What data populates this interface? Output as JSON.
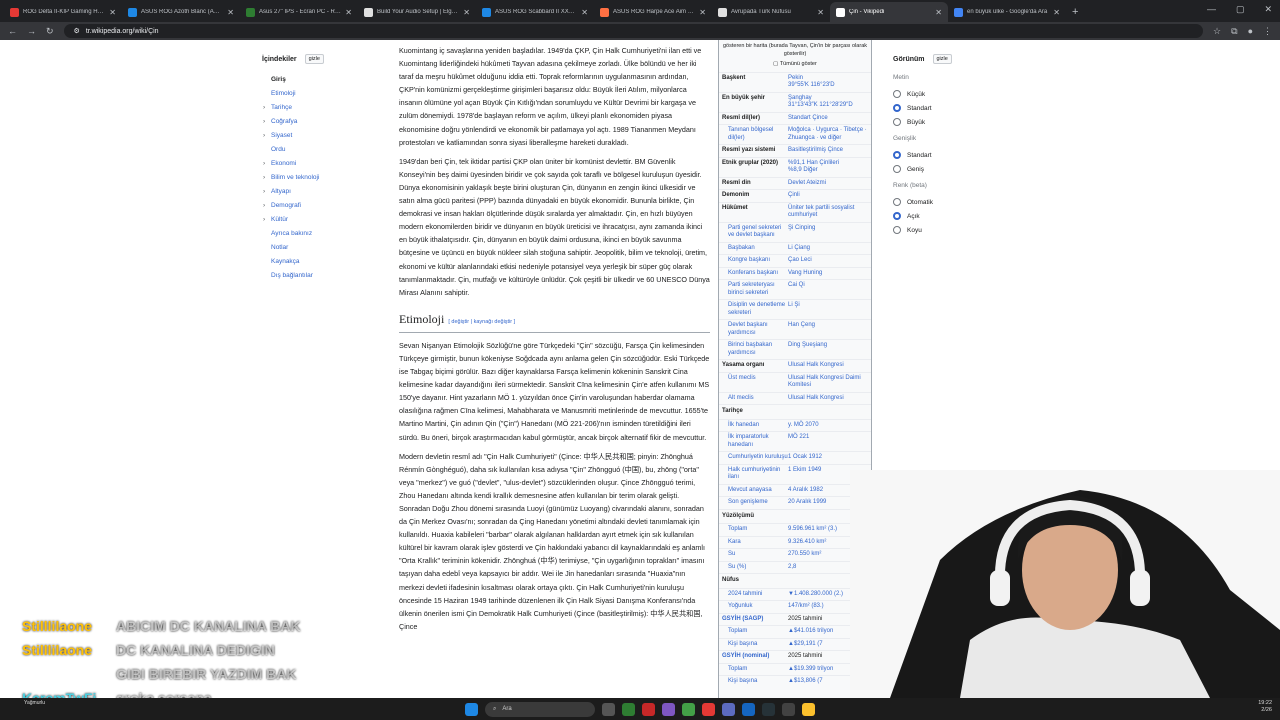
{
  "tabs": [
    {
      "label": "ROG Delta II-KIP Gaming Head",
      "color": "#e53935"
    },
    {
      "label": "ASUS ROG Azoth Blanc (AZERTY)",
      "color": "#1e88e5"
    },
    {
      "label": "Asus 27\" IPS - Ecran PC - Rue du",
      "color": "#2e7d32"
    },
    {
      "label": "Build Your Audio Setup | Elgato",
      "color": "#e0e0e0"
    },
    {
      "label": "ASUS ROG Scabbard II XXL (Ani",
      "color": "#1e88e5"
    },
    {
      "label": "ASUS ROG Harpe Ace Aim Lab",
      "color": "#ff7043"
    },
    {
      "label": "Avrupada Türk Nüfusu",
      "color": "#e0e0e0"
    },
    {
      "label": "Çin - Vikipedi",
      "color": "#ffffff",
      "active": true
    },
    {
      "label": "en büyük ülke - Google'da Ara",
      "color": "#4285f4"
    }
  ],
  "newtab": "+",
  "url": "tr.wikipedia.org/wiki/Çin",
  "toc": {
    "title": "İçindekiler",
    "hide": "gizle",
    "items": [
      {
        "label": "Giriş",
        "current": true,
        "chevron": false
      },
      {
        "label": "Etimoloji",
        "chevron": false
      },
      {
        "label": "Tarihçe",
        "chevron": true
      },
      {
        "label": "Coğrafya",
        "chevron": true
      },
      {
        "label": "Siyaset",
        "chevron": true
      },
      {
        "label": "Ordu",
        "chevron": false
      },
      {
        "label": "Ekonomi",
        "chevron": true
      },
      {
        "label": "Bilim ve teknoloji",
        "chevron": true
      },
      {
        "label": "Altyapı",
        "chevron": true
      },
      {
        "label": "Demografi",
        "chevron": true
      },
      {
        "label": "Kültür",
        "chevron": true
      },
      {
        "label": "Ayrıca bakınız",
        "chevron": false
      },
      {
        "label": "Notlar",
        "chevron": false
      },
      {
        "label": "Kaynakça",
        "chevron": false
      },
      {
        "label": "Dış bağlantılar",
        "chevron": false
      }
    ]
  },
  "article": {
    "p1": "Kuomintang iç savaşlarına yeniden başladılar. 1949'da ÇKP, Çin Halk Cumhuriyeti'ni ilan etti ve Kuomintang liderliğindeki hükûmeti Tayvan adasına çekilmeye zorladı. Ülke bölündü ve her iki taraf da meşru hükûmet olduğunu iddia etti. Toprak reformlarının uygulanmasının ardından, ÇKP'nin komünizmi gerçekleştirme girişimleri başarısız oldu: Büyük İleri Atılım, milyonlarca insanın ölümüne yol açan Büyük Çin Kıtlığı'ndan sorumluydu ve Kültür Devrimi bir kargaşa ve zulüm dönemiydi. 1978'de başlayan reform ve açılım, ülkeyi planlı ekonomiden piyasa ekonomisine doğru yönlendirdi ve ekonomik bir patlamaya yol açtı. 1989 Tiananmen Meydanı protestoları ve katliamından sonra siyasi liberalleşme hareketi durakladı.",
    "p2": "1949'dan beri Çin, tek iktidar partisi ÇKP olan üniter bir komünist devlettir. BM Güvenlik Konseyi'nin beş daimi üyesinden biridir ve çok sayıda çok taraflı ve bölgesel kuruluşun üyesidir. Dünya ekonomisinin yaklaşık beşte birini oluşturan Çin, dünyanın en zengin ikinci ülkesidir ve satın alma gücü paritesi (PPP) bazında dünyadaki en büyük ekonomidir. Bununla birlikte, Çin demokrasi ve insan hakları ölçütlerinde düşük sıralarda yer almaktadır. Çin, en hızlı büyüyen modern ekonomilerden biridir ve dünyanın en büyük üreticisi ve ihracatçısı, aynı zamanda ikinci en büyük ithalatçısıdır. Çin, dünyanın en büyük daimi ordusuna, ikinci en büyük savunma bütçesine ve üçüncü en büyük nükleer silah stoğuna sahiptir. Jeopolitik, bilim ve teknoloji, üretim, ekonomi ve kültür alanlarındaki etkisi nedeniyle potansiyel veya yerleşik bir süper güç olarak tanımlanmaktadır. Çin, mutfağı ve kültürüyle ünlüdür. Çok çeşitli bir ülkedir ve 60 UNESCO Dünya Mirası Alanını sahiptir.",
    "h_etimoloji": "Etimoloji",
    "h_edit": "[ değiştir | kaynağı değiştir ]",
    "p3": "Sevan Nişanyan Etimolojik Sözlüğü'ne göre Türkçedeki \"Çin\" sözcüğü, Farsça Çin kelimesinden Türkçeye girmiştir, bunun kökeniyse Soğdcada aynı anlama gelen Çin sözcüğüdür. Eski Türkçede ise Tabgaç biçimi görülür. Bazı diğer kaynaklarsa Farsça kelimenin kökeninin Sanskrit Cina kelimesine kadar dayandığını ileri sürmektedir. Sanskrit Cīna kelimesinin Çin'e atfen kullanımı MS 150'ye dayanır. Hint yazarların MÖ 1. yüzyıldan önce Çin'in varoluşundan haberdar olamama olasılığına rağmen Cīna kelimesi, Mahabharata ve Manusmriti metinlerinde de mevcuttur. 1655'te Martino Martini, Çin adının Qin (\"Çin\") Hanedanı (MÖ 221-206)'nın isminden türetildiğini ileri sürdü. Bu öneri, birçok araştırmacıdan kabul görmüştür, ancak birçok alternatif fikir de mevcuttur.",
    "p4": "Modern devletin resmî adı \"Çin Halk Cumhuriyeti\" (Çince: 中华人民共和国; pinyin: Zhōnghuá Rénmín Gònghéguó), daha sık kullanılan kısa adıysa \"Çin\" Zhōngguó (中国), bu, zhōng (\"orta\" veya \"merkez\") ve guó (\"devlet\", \"ulus-devlet\") sözcüklerinden oluşur. Çince Zhōngguó terimi, Zhou Hanedanı altında kendi krallık demesnesine atfen kullanılan bir terim olarak gelişti. Sonradan Doğu Zhou dönemi sırasında Luoyi (günümüz Luoyang) civarındaki alanını, sonradan da Çin Merkez Ovası'nı; sonradan da Çing Hanedanı yönetimi altındaki devleti tanımlamak için kullanıldı. Huaxia kabileleri \"barbar\" olarak algılanan halklardan ayırt etmek için sık kullanılan kültürel bir kavram olarak işlev gösterdi ve Çin hakkındaki yabancı dil kaynaklarındaki eş anlamlı \"Orta Krallık\" teriminin kökenidir. Zhōnghuá (中华) terimiyse, \"Çin uygarlığının toprakları\" imasını taşıyan daha edebî veya kapsayıcı bir addır. Wei ile Jin hanedanları sırasında \"Huaxia\"nın merkezi devleti ifadesinin kısaltması olarak ortaya çıktı. Çin Halk Cumhuriyeti'nin kuruluşu öncesinde 15 Haziran 1949 tarihinde düzenlenen ilk Çin Halk Siyasi Danışma Konferansı'nda ülkenin önerilen ismi Çin Demokratik Halk Cumhuriyeti (Çince (basitleştirilmiş): 中华人民共和国, Çince"
  },
  "infobox": {
    "top_note": "gösteren bir harita (burada Tayvan, Çin'in bir parçası olarak gösterilir)",
    "show_all": "Tümünü göster",
    "rows": [
      {
        "k": "Başkent",
        "v": "Pekin\n39°55′K 116°23′D"
      },
      {
        "k": "En büyük şehir",
        "v": "Şanghay\n31°13′43″K 121°28′29″D"
      },
      {
        "k": "Resmî dil(ler)",
        "v": "Standart Çince"
      },
      {
        "k": "Tanınan bölgesel dil(ler)",
        "v": "Moğolca · Uygurca · Tibetçe · Zhuangca · ve diğer",
        "sub": true
      },
      {
        "k": "Resmî yazı sistemi",
        "v": "Basitleştirilmiş Çince"
      },
      {
        "k": "Etnik gruplar (2020)",
        "v": "%91,1 Han Çinlileri\n%8,9 Diğer"
      },
      {
        "k": "Resmî din",
        "v": "Devlet Ateizmi"
      },
      {
        "k": "Demonim",
        "v": "Çinli"
      },
      {
        "k": "Hükûmet",
        "v": "Üniter tek partili sosyalist cumhuriyet"
      },
      {
        "k": "Parti genel sekreteri ve devlet başkanı",
        "v": "Şi Cinping",
        "sub": true
      },
      {
        "k": "Başbakan",
        "v": "Li Çiang",
        "sub": true
      },
      {
        "k": "Kongre başkanı",
        "v": "Çao Leci",
        "sub": true
      },
      {
        "k": "Konferans başkanı",
        "v": "Vang Huning",
        "sub": true
      },
      {
        "k": "Parti sekreteryası birinci sekreteri",
        "v": "Cai Qi",
        "sub": true
      },
      {
        "k": "Disiplin ve denetleme sekreteri",
        "v": "Li Şi",
        "sub": true
      },
      {
        "k": "Devlet başkanı yardımcısı",
        "v": "Han Çeng",
        "sub": true
      },
      {
        "k": "Birinci başbakan yardımcısı",
        "v": "Ding Şueşiang",
        "sub": true
      },
      {
        "k": "Yasama organı",
        "v": "Ulusal Halk Kongresi"
      },
      {
        "k": "Üst meclis",
        "v": "Ulusal Halk Kongresi Daimi Komitesi",
        "sub": true
      },
      {
        "k": "Alt meclis",
        "v": "Ulusal Halk Kongresi",
        "sub": true
      }
    ],
    "tarihce_title": "Tarihçe",
    "tarihce": [
      {
        "k": "İlk hanedan",
        "v": "y. MÖ 2070"
      },
      {
        "k": "İlk imparatorluk hanedanı",
        "v": "MÖ 221"
      },
      {
        "k": "Cumhuriyetin kuruluşu",
        "v": "1 Ocak 1912"
      },
      {
        "k": "Halk cumhuriyetinin ilanı",
        "v": "1 Ekim 1949"
      },
      {
        "k": "Mevcut anayasa",
        "v": "4 Aralık 1982"
      },
      {
        "k": "Son genişleme",
        "v": "20 Aralık 1999"
      }
    ],
    "yuz_title": "Yüzölçümü",
    "yuz": [
      {
        "k": "Toplam",
        "v": "9.596.961 km² (3.)"
      },
      {
        "k": "Kara",
        "v": "9.326.410 km²"
      },
      {
        "k": "Su",
        "v": "270.550 km²"
      },
      {
        "k": "Su (%)",
        "v": "2,8"
      }
    ],
    "nufus_title": "Nüfus",
    "nufus": [
      {
        "k": "2024 tahmini",
        "v": "▼1.408.280.000 (2.)"
      },
      {
        "k": "Yoğunluk",
        "v": "147/km² (83.)"
      }
    ],
    "gsyih_ppp_title": "GSYİH (SAGP)",
    "gsyih_ppp_year": "2025 tahmini",
    "gsyih_ppp": [
      {
        "k": "Toplam",
        "v": "▲$41.016 trilyon"
      },
      {
        "k": "Kişi başına",
        "v": "▲$29,191 (7"
      }
    ],
    "gsyih_nom_title": "GSYİH (nominal)",
    "gsyih_nom_year": "2025 tahmini",
    "gsyih_nom": [
      {
        "k": "Toplam",
        "v": "▲$19.399 trilyon"
      },
      {
        "k": "Kişi başına",
        "v": "▲$13,806 (7"
      }
    ]
  },
  "appearance": {
    "title": "Görünüm",
    "hide": "gizle",
    "groups": [
      {
        "name": "Metin",
        "options": [
          {
            "label": "Küçük",
            "on": false
          },
          {
            "label": "Standart",
            "on": true
          },
          {
            "label": "Büyük",
            "on": false
          }
        ]
      },
      {
        "name": "Genişlik",
        "options": [
          {
            "label": "Standart",
            "on": true
          },
          {
            "label": "Geniş",
            "on": false
          }
        ]
      },
      {
        "name": "Renk (beta)",
        "options": [
          {
            "label": "Otomatik",
            "on": false
          },
          {
            "label": "Açık",
            "on": true
          },
          {
            "label": "Koyu",
            "on": false
          }
        ]
      }
    ]
  },
  "chat": [
    {
      "user": "Stilllilaone",
      "user_color": "#ffc107",
      "msg": "ABICIM DC KANALINA BAK"
    },
    {
      "user": "Stilllilaone",
      "user_color": "#ffc107",
      "msg": "DC KANALINA DEDIGIN"
    },
    {
      "user": "",
      "user_color": "#ffc107",
      "msg": "GIBI BIREBIR YAZDIM BAK"
    },
    {
      "user": "KeremTwFj",
      "user_color": "#4dd0e1",
      "msg": "groka sorsana"
    }
  ],
  "taskbar": {
    "search": "Ara",
    "weather_line1": "",
    "weather_line2": "Yağmurlu",
    "time": "19:22",
    "date": "2/26"
  }
}
